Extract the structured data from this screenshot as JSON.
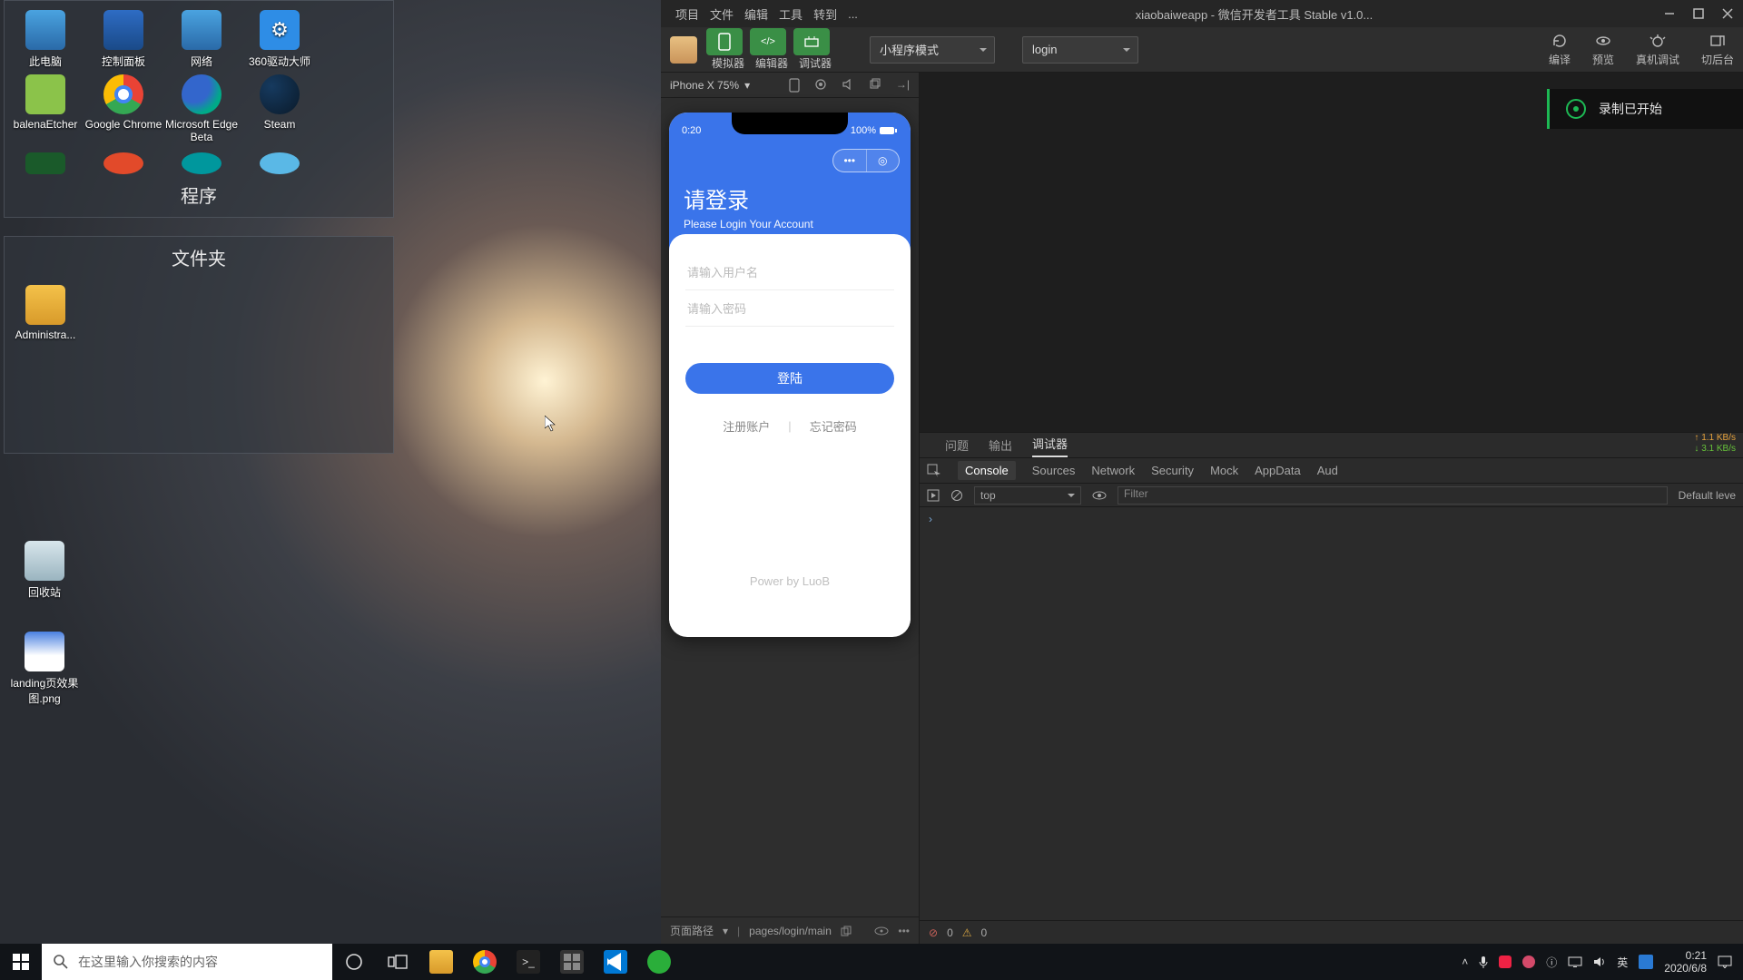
{
  "desktop": {
    "fence_programs_title": "程序",
    "fence_folders_title": "文件夹",
    "icons_row1": [
      "此电脑",
      "控制面板",
      "网络",
      "360驱动大师"
    ],
    "icons_row2": [
      "balenaEtcher",
      "Google Chrome",
      "Microsoft Edge Beta",
      "Steam"
    ],
    "folder_user": "Administra...",
    "recycle": "回收站",
    "landing_png": "landing页效果图.png"
  },
  "devtools": {
    "menu": {
      "project": "项目",
      "file": "文件",
      "edit": "编辑",
      "tool": "工具",
      "goto": "转到",
      "more": "..."
    },
    "window_title": "xiaobaiweapp - 微信开发者工具 Stable v1.0...",
    "toolbar": {
      "mode_labels": {
        "sim": "模拟器",
        "editor": "编辑器",
        "debugger": "调试器"
      },
      "mode_select": "小程序模式",
      "page_select": "login",
      "right": {
        "compile": "编译",
        "preview": "预览",
        "real": "真机调试",
        "back": "切后台"
      }
    },
    "simulator": {
      "device": "iPhone X 75%",
      "status_time": "0:20",
      "status_batt": "100%",
      "login_title": "请登录",
      "login_sub": "Please Login Your Account",
      "ph_user": "请输入用户名",
      "ph_pass": "请输入密码",
      "btn_login": "登陆",
      "link_register": "注册账户",
      "link_forgot": "忘记密码",
      "divider": "|",
      "powerby": "Power by LuoB",
      "footer": {
        "route_label": "页面路径",
        "route_value": "pages/login/main"
      }
    },
    "recording_toast": "录制已开始",
    "debugger": {
      "tabs_top": {
        "issues": "问题",
        "output": "输出",
        "debugger": "调试器"
      },
      "net_up": "↑ 1.1 KB/s",
      "net_dn": "↓ 3.1 KB/s",
      "tabs_dev": {
        "console": "Console",
        "sources": "Sources",
        "network": "Network",
        "security": "Security",
        "mock": "Mock",
        "appdata": "AppData",
        "audits": "Aud"
      },
      "top_ctx": "top",
      "filter_ph": "Filter",
      "level": "Default leve",
      "prompt": "›",
      "footer_err": "0",
      "footer_warn": "0"
    }
  },
  "taskbar": {
    "search_placeholder": "在这里输入你搜索的内容",
    "ime": "英",
    "time": "0:21",
    "date": "2020/6/8"
  }
}
